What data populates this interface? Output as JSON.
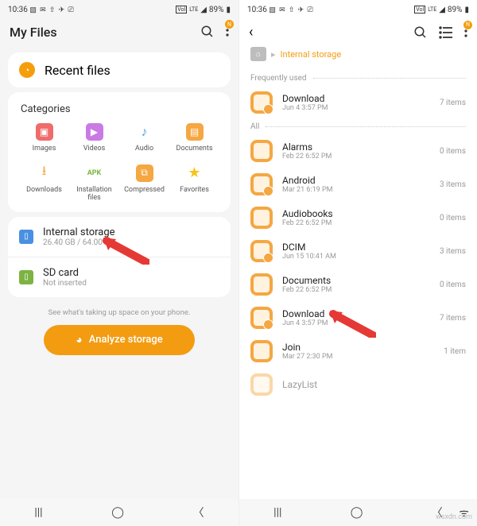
{
  "statusbar": {
    "time": "10:36",
    "battery": "89%",
    "vol": "Vol",
    "lte": "LTE"
  },
  "left": {
    "title": "My Files",
    "recent": "Recent files",
    "categories_title": "Categories",
    "categories": [
      {
        "label": "Images"
      },
      {
        "label": "Videos"
      },
      {
        "label": "Audio"
      },
      {
        "label": "Documents"
      },
      {
        "label": "Downloads"
      },
      {
        "label": "Installation\nfiles"
      },
      {
        "label": "Compressed"
      },
      {
        "label": "Favorites"
      }
    ],
    "storage": {
      "internal": {
        "title": "Internal storage",
        "sub": "26.40 GB / 64.00 GB"
      },
      "sd": {
        "title": "SD card",
        "sub": "Not inserted"
      }
    },
    "analyze_hint": "See what's taking up space on your phone.",
    "analyze_btn": "Analyze storage",
    "badge": "N"
  },
  "right": {
    "breadcrumb": "Internal storage",
    "sections": {
      "freq": "Frequently used",
      "all": "All"
    },
    "badge": "N",
    "folders": [
      {
        "name": "Download",
        "date": "Jun 4 3:57 PM",
        "count": "7 items",
        "badge": true,
        "section": "freq"
      },
      {
        "name": "Alarms",
        "date": "Feb 22 6:52 PM",
        "count": "0 items",
        "section": "all"
      },
      {
        "name": "Android",
        "date": "Mar 21 6:19 PM",
        "count": "3 items",
        "badge": true,
        "section": "all"
      },
      {
        "name": "Audiobooks",
        "date": "Feb 22 6:52 PM",
        "count": "0 items",
        "section": "all"
      },
      {
        "name": "DCIM",
        "date": "Jun 15 10:41 AM",
        "count": "3 items",
        "badge": true,
        "section": "all"
      },
      {
        "name": "Documents",
        "date": "Feb 22 6:52 PM",
        "count": "0 items",
        "section": "all"
      },
      {
        "name": "Download",
        "date": "Jun 4 3:57 PM",
        "count": "7 items",
        "badge": true,
        "section": "all"
      },
      {
        "name": "Join",
        "date": "Mar 27 2:30 PM",
        "count": "1 item",
        "section": "all"
      },
      {
        "name": "LazyList",
        "date": "",
        "count": "",
        "section": "all"
      }
    ]
  },
  "watermark": "wsxdn.com"
}
